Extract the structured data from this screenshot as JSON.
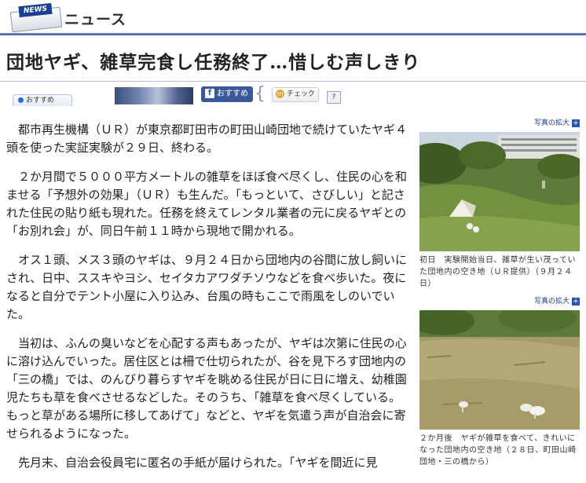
{
  "header": {
    "icon_tag": "NEWS",
    "section_title": "ニュース"
  },
  "headline": "団地ヤギ、雑草完食し任務終了…惜しむ声しきり",
  "social": {
    "recommend_tab": "おすすめ",
    "facebook_label": "おすすめ",
    "mixi_label": "チェック",
    "help_label": "?"
  },
  "article": {
    "paragraphs": [
      "都市再生機構（ＵＲ）が東京都町田市の町田山崎団地で続けていたヤギ４頭を使った実証実験が２９日、終わる。",
      "２か月間で５０００平方メートルの雑草をほぼ食べ尽くし、住民の心を和ませる「予想外の効果」（ＵＲ）も生んだ。「もっといて、さびしい」と記された住民の貼り紙も現れた。任務を終えてレンタル業者の元に戻るヤギとの「お別れ会」が、同日午前１１時から現地で開かれる。",
      "オス１頭、メス３頭のヤギは、９月２４日から団地内の谷間に放し飼いにされ、日中、ススキやヨシ、セイタカアワダチソウなどを食べ歩いた。夜になると自分でテント小屋に入り込み、台風の時もここで雨風をしのいでいた。",
      "当初は、ふんの臭いなどを心配する声もあったが、ヤギは次第に住民の心に溶け込んでいった。居住区とは柵で仕切られたが、谷を見下ろす団地内の「三の橋」では、のんびり暮らすヤギを眺める住民が日に日に増え、幼稚園児たちも草を食べさせるなどした。そのうち、「雑草を食べ尽くしている。もっと草がある場所に移してあげて」などと、ヤギを気遣う声が自治会に寄せられるようになった。",
      "先月末、自治会役員宅に匿名の手紙が届けられた。「ヤギを間近に見"
    ]
  },
  "sidebar": {
    "photos": [
      {
        "enlarge_label": "写真の拡大",
        "caption": "初日　実験開始当日、雑草が生い茂っていた団地内の空き地（ＵＲ提供）（９月２４日）"
      },
      {
        "enlarge_label": "写真の拡大",
        "caption": "２か月後　ヤギが雑草を食べて、きれいになった団地内の空き地（２８日、町田山崎団地・三の橋から）"
      }
    ]
  },
  "colors": {
    "header_rule": "#3f58a8",
    "facebook": "#3b5998",
    "link": "#1e3f88"
  }
}
